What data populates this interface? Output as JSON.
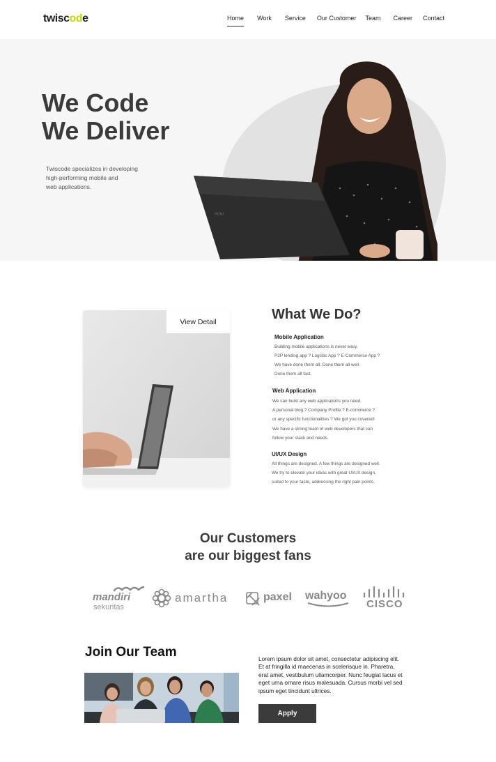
{
  "logo": {
    "text_pre": "twisc",
    "text_oo": "od",
    "text_post": "e"
  },
  "nav": [
    "Home",
    "Work",
    "Service",
    "Our Customer",
    "Team",
    "Career",
    "Contact"
  ],
  "hero": {
    "title_line1": "We Code",
    "title_line2": "We Deliver",
    "desc_lines": [
      "Twiscode specializes in developing",
      "high-performing mobile and",
      "web applications."
    ]
  },
  "what_we_do": {
    "view_detail": "View Detail",
    "title": "What We Do?",
    "services": [
      {
        "heading": "Mobile Application",
        "lines": [
          "Building mobile applications is never easy.",
          "P2P lending app ? Logistic App ? E-Commerce App ?",
          "We have done them all. Done them all well.",
          "Done them all fast."
        ]
      },
      {
        "heading": "Web Application",
        "lines": [
          "We can build any web applications you need.",
          "A personal blog ? Company Profile ? E-commerce ?",
          "or any specific functionalities ? We got you covered!",
          "We have a strong team of web developers that can",
          "follow your stack and needs."
        ]
      },
      {
        "heading": "UI/UX Design",
        "lines": [
          "All things are designed. A few things are designed well.",
          "We try to elevate your ideas with great UI/UX design,",
          "suited to your taste, addressing the right pain points."
        ]
      }
    ]
  },
  "customers": {
    "title_line1": "Our Customers",
    "title_line2": "are our biggest fans",
    "logos": {
      "mandiri_top": "mandiri",
      "mandiri_bottom": "sekuritas",
      "amartha": "amartha",
      "paxel": "paxel",
      "wahyoo": "wahyoo",
      "cisco": "CISCO"
    }
  },
  "join": {
    "title": "Join Our Team",
    "text": "Lorem ipsum dolor sit amet, consectetur adipiscing elit. Et at fringilla id maecenas in scelerisque in. Pharetra, erat amet, vestibulum ullamcorper. Nunc feugiat lacus et eget urna ornare risus malesuada. Cursus morbi vel sed ipsum eget tincidunt ultrices.",
    "apply": "Apply"
  }
}
